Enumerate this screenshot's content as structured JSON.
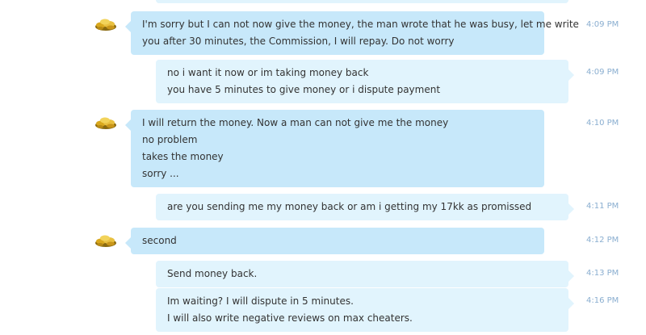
{
  "colors": {
    "incoming_bubble": "#c7e8fa",
    "outgoing_bubble": "#e1f4fd",
    "timestamp": "#8aaed0",
    "text": "#333333"
  },
  "avatar_icon": "gold-coins-avatar-icon",
  "messages": [
    {
      "direction": "incoming",
      "time": "4:09 PM",
      "lines": [
        "I'm sorry but I can not now give the money, the man wrote that he was busy, let me write",
        "you after 30 minutes, the Commission, I will repay. Do not worry"
      ]
    },
    {
      "direction": "outgoing",
      "time": "4:09 PM",
      "lines": [
        "no i want it now or im taking money back",
        "you have 5 minutes to give money or i dispute payment"
      ]
    },
    {
      "direction": "incoming",
      "time": "4:10 PM",
      "lines": [
        "I will return the money. Now a man can not give me the money",
        "no problem",
        "takes the money",
        "sorry ..."
      ]
    },
    {
      "direction": "outgoing",
      "time": "4:11 PM",
      "lines": [
        "are you sending me my money back or am i getting my 17kk as promissed"
      ]
    },
    {
      "direction": "incoming",
      "time": "4:12 PM",
      "lines": [
        "second"
      ]
    },
    {
      "direction": "outgoing",
      "time": "4:13 PM",
      "lines": [
        "Send money back."
      ]
    },
    {
      "direction": "outgoing",
      "time": "4:16 PM",
      "lines": [
        "Im waiting? I will dispute in 5 minutes.",
        "I will also write negative reviews on max cheaters."
      ]
    }
  ]
}
